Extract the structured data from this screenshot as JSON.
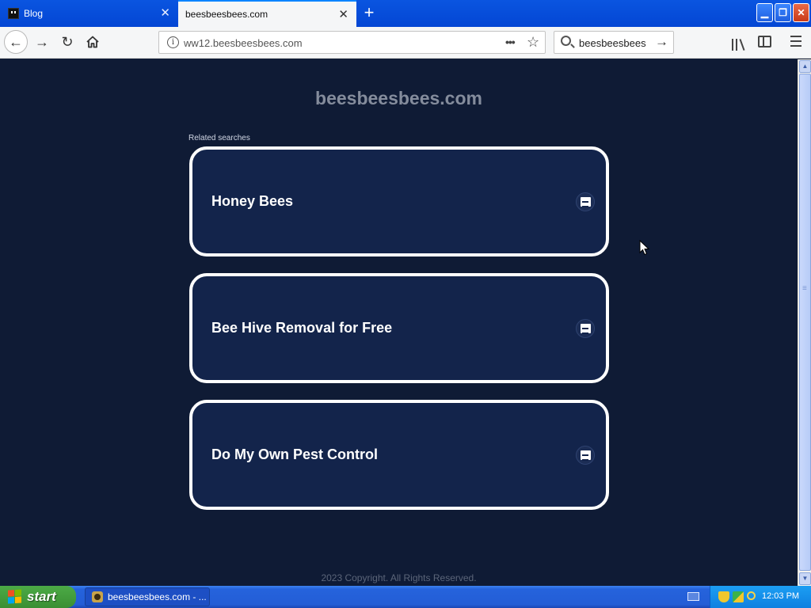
{
  "browser": {
    "tabs": [
      {
        "label": "Blog",
        "active": false
      },
      {
        "label": "beesbeesbees.com",
        "active": true
      }
    ],
    "url": "ww12.beesbeesbees.com",
    "search_value": "beesbeesbees"
  },
  "page": {
    "site_title": "beesbeesbees.com",
    "related_label": "Related searches",
    "cards": [
      {
        "label": "Honey Bees"
      },
      {
        "label": "Bee Hive Removal for Free"
      },
      {
        "label": "Do My Own Pest Control"
      }
    ],
    "footer": "2023 Copyright. All Rights Reserved."
  },
  "taskbar": {
    "start_label": "start",
    "task_item": "beesbeesbees.com - ...",
    "clock": "12:03 PM"
  },
  "colors": {
    "page_background": "#0f1b35",
    "card_background": "#13244b",
    "card_border": "#ffffff",
    "tab_bar": "#0346d4",
    "taskbar": "#245dd6",
    "start_button": "#3a8f33"
  },
  "icons": [
    "back-icon",
    "forward-icon",
    "reload-icon",
    "home-icon",
    "info-icon",
    "more-icon",
    "bookmark-star-icon",
    "search-icon",
    "go-arrow-icon",
    "library-icon",
    "sidebar-icon",
    "menu-icon",
    "image-icon",
    "windows-logo-icon",
    "shield-icon",
    "network-icon",
    "magnifier-icon",
    "keyboard-icon",
    "mouse-cursor-icon"
  ]
}
